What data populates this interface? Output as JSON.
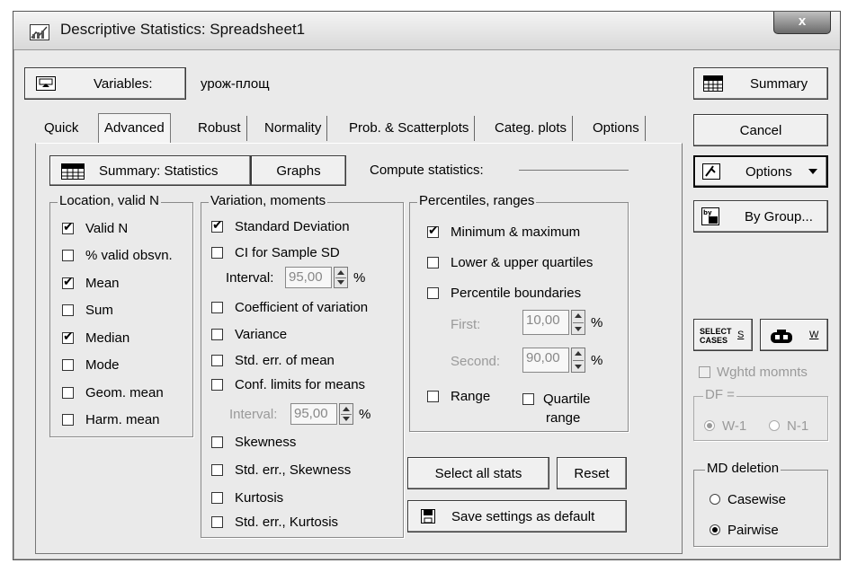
{
  "window": {
    "title": "Descriptive Statistics: Spreadsheet1",
    "close_label": "x"
  },
  "top": {
    "variables_label": "Variables:",
    "variables_value": "урож-площ"
  },
  "tabs": [
    {
      "label": "Quick"
    },
    {
      "label": "Advanced"
    },
    {
      "label": "Robust"
    },
    {
      "label": "Normality"
    },
    {
      "label": "Prob. & Scatterplots"
    },
    {
      "label": "Categ. plots"
    },
    {
      "label": "Options"
    }
  ],
  "panel": {
    "summary_stats_label": "Summary: Statistics",
    "graphs_label": "Graphs",
    "compute_label": "Compute statistics:"
  },
  "location": {
    "title": "Location, valid N",
    "items": [
      {
        "label": "Valid N",
        "checked": true
      },
      {
        "label": "% valid obsvn.",
        "checked": false
      },
      {
        "label": "Mean",
        "checked": true
      },
      {
        "label": "Sum",
        "checked": false
      },
      {
        "label": "Median",
        "checked": true
      },
      {
        "label": "Mode",
        "checked": false
      },
      {
        "label": "Geom. mean",
        "checked": false
      },
      {
        "label": "Harm. mean",
        "checked": false
      }
    ]
  },
  "variation": {
    "title": "Variation, moments",
    "std_dev": "Standard Deviation",
    "ci_sd": "CI for Sample SD",
    "interval_label": "Interval:",
    "interval_value": "95,00",
    "pct": "%",
    "coef_var": "Coefficient of variation",
    "variance": "Variance",
    "std_err_mean": "Std. err. of mean",
    "conf_limits": "Conf. limits for means",
    "interval2_label": "Interval:",
    "interval2_value": "95,00",
    "skewness": "Skewness",
    "std_err_skew": "Std. err., Skewness",
    "kurtosis": "Kurtosis",
    "std_err_kurt": "Std. err., Kurtosis"
  },
  "percentiles": {
    "title": "Percentiles, ranges",
    "minmax": "Minimum & maximum",
    "quartiles": "Lower & upper quartiles",
    "pct_boundaries": "Percentile boundaries",
    "first_label": "First:",
    "first_value": "10,00",
    "second_label": "Second:",
    "second_value": "90,00",
    "pct": "%",
    "range": "Range",
    "quartile_range_1": "Quartile",
    "quartile_range_2": "range"
  },
  "bottom_buttons": {
    "select_all": "Select all stats",
    "reset": "Reset",
    "save_default": "Save settings as default"
  },
  "right": {
    "summary": "Summary",
    "cancel": "Cancel",
    "options": "Options",
    "by_group": "By Group...",
    "select_cases_icon_text": "SELECT CASES",
    "s_label": "S",
    "w_label": "W",
    "weighted": "Wghtd momnts",
    "df_label": "DF =",
    "df_w1": "W-1",
    "df_n1": "N-1",
    "md_title": "MD deletion",
    "casewise": "Casewise",
    "pairwise": "Pairwise"
  }
}
